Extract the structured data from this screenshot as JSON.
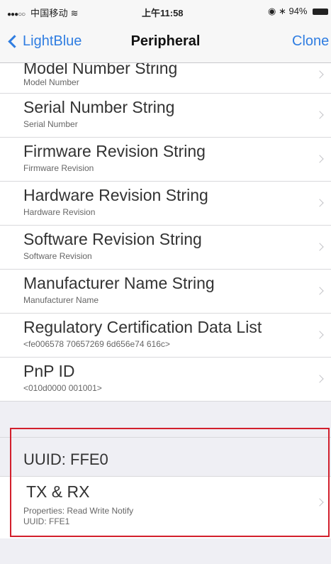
{
  "status_bar": {
    "signal": "●●●○○",
    "carrier": "中国移动",
    "wifi": "≋",
    "time": "上午11:58",
    "right": "◉ ∗ 94%"
  },
  "nav": {
    "back_label": "LightBlue",
    "title": "Peripheral",
    "action_label": "Clone"
  },
  "rows": [
    {
      "title": "Model Number String",
      "subtitle": "Model Number"
    },
    {
      "title": "Serial Number String",
      "subtitle": "Serial Number"
    },
    {
      "title": "Firmware Revision String",
      "subtitle": "Firmware Revision"
    },
    {
      "title": "Hardware Revision String",
      "subtitle": "Hardware Revision"
    },
    {
      "title": "Software Revision String",
      "subtitle": "Software Revision"
    },
    {
      "title": "Manufacturer Name String",
      "subtitle": "Manufacturer Name"
    },
    {
      "title": "Regulatory Certification Data List",
      "subtitle": "<fe006578 70657269 6d656e74 616c>"
    },
    {
      "title": "PnP ID",
      "subtitle": "<010d0000 001001>"
    }
  ],
  "service": {
    "uuid_header": "UUID: FFE0",
    "characteristic": {
      "title": "TX & RX",
      "properties": "Properties: Read Write Notify",
      "uuid": "UUID: FFE1"
    }
  },
  "colors": {
    "accent": "#2f7de1",
    "highlight": "#d21f2c"
  }
}
